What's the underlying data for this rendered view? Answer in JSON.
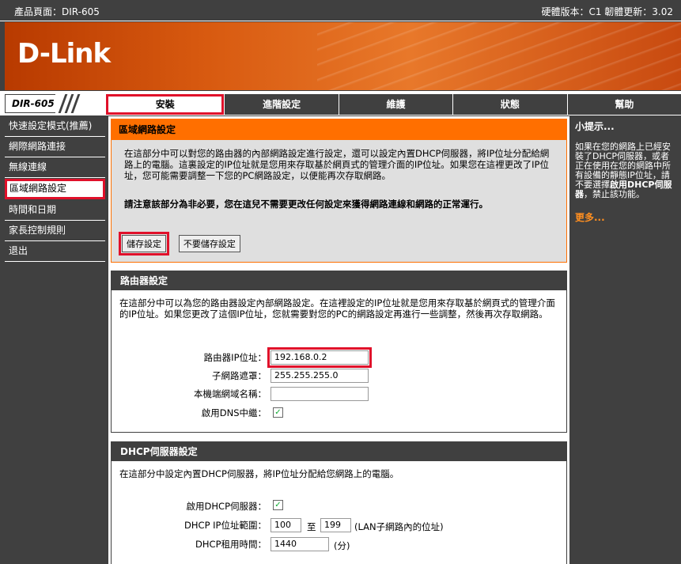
{
  "header": {
    "product_page": "產品頁面：DIR-605",
    "version": "硬體版本：C1   韌體更新：3.02"
  },
  "logo": "D-Link",
  "model": "DIR-605",
  "tabs": [
    {
      "label": "安裝",
      "active": true
    },
    {
      "label": "進階設定"
    },
    {
      "label": "維護"
    },
    {
      "label": "狀態"
    },
    {
      "label": "幫助"
    }
  ],
  "sidebar": {
    "items": [
      {
        "label": "快速設定模式(推薦)"
      },
      {
        "label": "網際網路連接"
      },
      {
        "label": "無線連線"
      },
      {
        "label": "區域網路設定",
        "active": true
      },
      {
        "label": "時間和日期"
      },
      {
        "label": "家長控制規則"
      },
      {
        "label": "退出"
      }
    ]
  },
  "lan": {
    "title": "區域網路設定",
    "description": "在這部分中可以對您的路由器的內部網路設定進行設定，還可以設定內置DHCP伺服器，將IP位址分配給網路上的電腦。這裏設定的IP位址就是您用來存取基於網頁式的管理介面的IP位址。如果您在這裡更改了IP位址，您可能需要調整一下您的PC網路設定，以便能再次存取網路。",
    "warning": "請注意該部分為非必要，您在這兒不需要更改任何設定來獲得網路連線和網路的正常運行。",
    "save_label": "儲存設定",
    "nosave_label": "不要儲存設定"
  },
  "router": {
    "title": "路由器設定",
    "description": "在這部分中可以為您的路由器設定內部網路設定。在這裡設定的IP位址就是您用來存取基於網頁式的管理介面的IP位址。如果您更改了這個IP位址，您就需要對您的PC的網路設定再進行一些調整，然後再次存取網路。",
    "ip_label": "路由器IP位址：",
    "ip_value": "192.168.0.2",
    "mask_label": "子網路遮罩：",
    "mask_value": "255.255.255.0",
    "domain_label": "本機端網域名稱：",
    "domain_value": "",
    "dns_label": "啟用DNS中繼：",
    "dns_checked": "✓"
  },
  "dhcp": {
    "title": "DHCP伺服器設定",
    "description": "在這部分中設定內置DHCP伺服器，將IP位址分配給您網路上的電腦。",
    "enable_label": "啟用DHCP伺服器：",
    "enable_checked": "✓",
    "range_label": "DHCP IP位址範圍：",
    "range_start": "100",
    "range_to": "至",
    "range_end": "199",
    "range_note": "(LAN子網路內的位址)",
    "lease_label": "DHCP租用時間：",
    "lease_value": "1440",
    "lease_unit": "(分)"
  },
  "hints": {
    "title": "小提示...",
    "text_before": "如果在您的網路上已經安裝了DHCP伺服器，或者正在使用在您的網路中所有設備的靜態IP位址，請不要選擇",
    "text_bold": "啟用DHCP伺服器",
    "text_after": "，禁止該功能。",
    "more": "更多..."
  },
  "colors": {
    "accent_orange": "#ff6f00",
    "highlight_red": "#e0102a",
    "dark_gray": "#404040"
  }
}
